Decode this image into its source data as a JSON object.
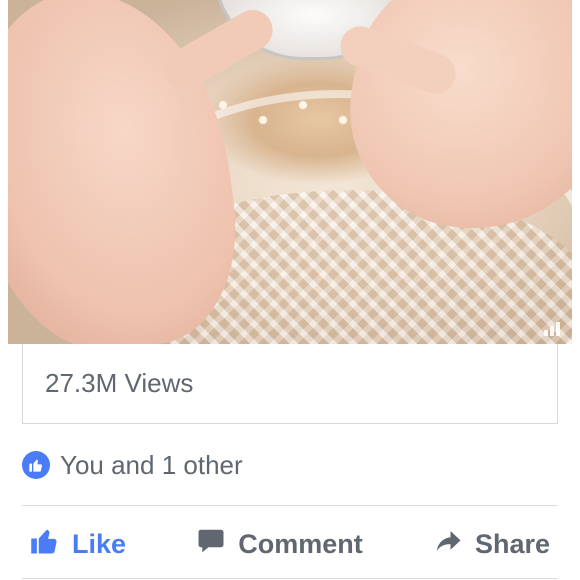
{
  "post": {
    "views": "27.3M Views",
    "reactions_text": "You and 1 other"
  },
  "actions": {
    "like_label": "Like",
    "comment_label": "Comment",
    "share_label": "Share"
  },
  "icons": {
    "like_badge": "thumbs-up-icon",
    "like": "thumbs-up-icon",
    "comment": "speech-bubble-icon",
    "share": "share-arrow-icon",
    "video_watermark": "bars-logo-icon"
  },
  "colors": {
    "accent": "#4a7cf6",
    "text_secondary": "#606770",
    "divider": "#dadde1"
  }
}
